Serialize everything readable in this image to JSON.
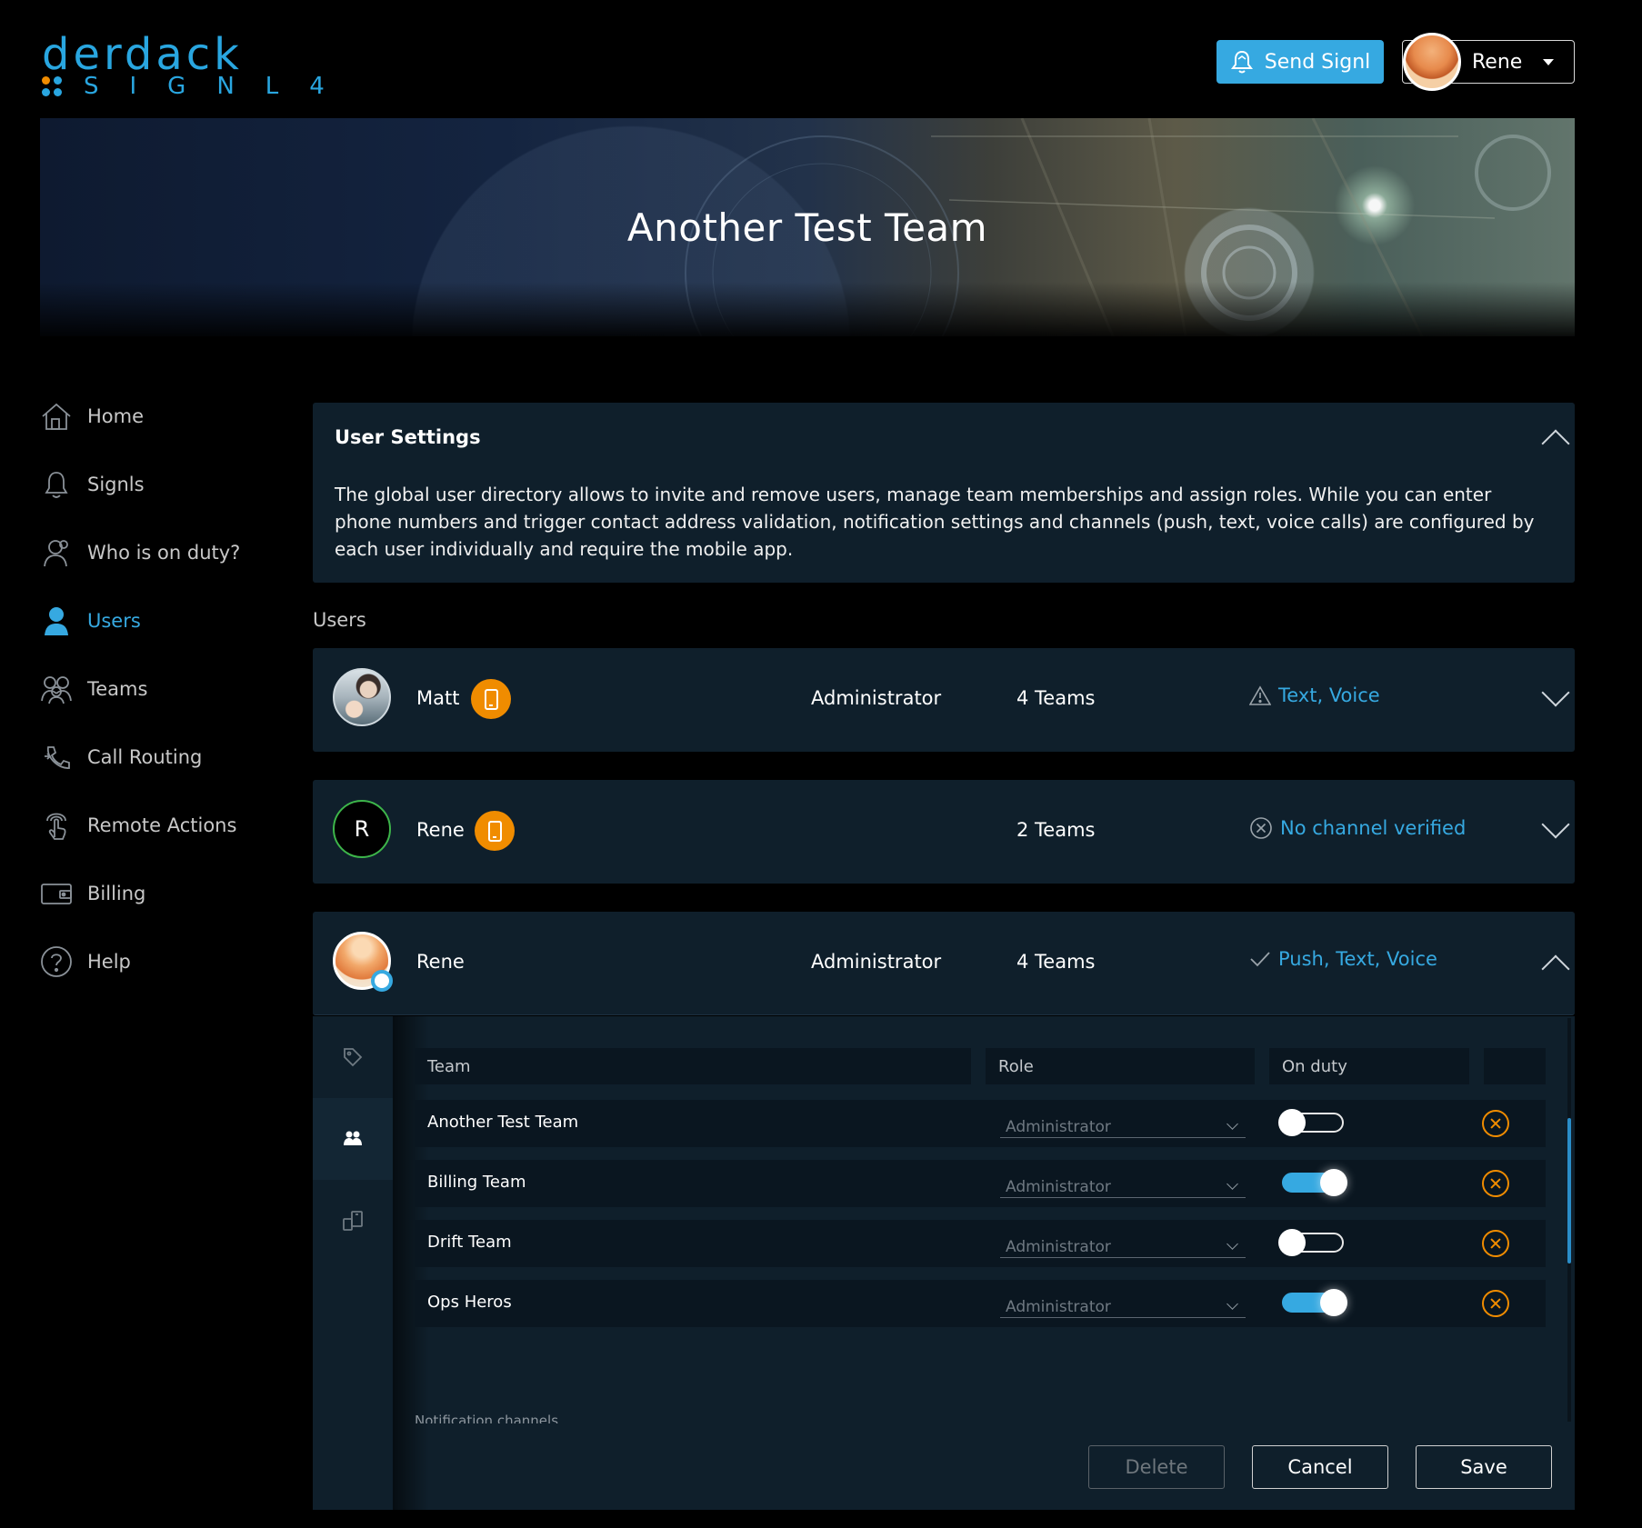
{
  "app": {
    "logo_top": "derdack",
    "logo_bottom": "SIGNL4"
  },
  "header": {
    "send_label": "Send Signl",
    "user_name": "Rene"
  },
  "banner": {
    "title": "Another Test Team"
  },
  "sidebar": {
    "items": [
      {
        "label": "Home",
        "icon": "home-icon"
      },
      {
        "label": "Signls",
        "icon": "bell-icon"
      },
      {
        "label": "Who is on duty?",
        "icon": "on-duty-icon"
      },
      {
        "label": "Users",
        "icon": "user-icon",
        "active": true
      },
      {
        "label": "Teams",
        "icon": "teams-icon"
      },
      {
        "label": "Call Routing",
        "icon": "call-routing-icon"
      },
      {
        "label": "Remote Actions",
        "icon": "remote-actions-icon"
      },
      {
        "label": "Billing",
        "icon": "billing-icon"
      },
      {
        "label": "Help",
        "icon": "help-icon"
      }
    ]
  },
  "settings": {
    "title": "User Settings",
    "text": "The global user directory allows to invite and remove users, manage team memberships and assign roles. While you can enter phone numbers and trigger contact address validation, notification settings and channels (push, text, voice calls) are configured by each user individually and require the mobile app."
  },
  "users_heading": "Users",
  "users": [
    {
      "name": "Matt",
      "role": "Administrator",
      "teams": "4 Teams",
      "channels": "Text, Voice",
      "status": "warning"
    },
    {
      "name": "Rene",
      "initial": "R",
      "role": "",
      "teams": "2 Teams",
      "channels": "No channel verified",
      "status": "none"
    },
    {
      "name": "Rene",
      "role": "Administrator",
      "teams": "4 Teams",
      "channels": "Push, Text, Voice",
      "status": "ok"
    }
  ],
  "team_table": {
    "headers": {
      "team": "Team",
      "role": "Role",
      "on_duty": "On duty"
    },
    "rows": [
      {
        "team": "Another Test Team",
        "role": "Administrator",
        "on_duty": false
      },
      {
        "team": "Billing Team",
        "role": "Administrator",
        "on_duty": true
      },
      {
        "team": "Drift Team",
        "role": "Administrator",
        "on_duty": false
      },
      {
        "team": "Ops Heros",
        "role": "Administrator",
        "on_duty": true
      }
    ]
  },
  "notif_label": "Notification channels",
  "actions": {
    "delete": "Delete",
    "cancel": "Cancel",
    "save": "Save"
  },
  "colors": {
    "accent": "#36a9e1",
    "warning": "#f08c00",
    "panel": "#0f1f2b"
  }
}
